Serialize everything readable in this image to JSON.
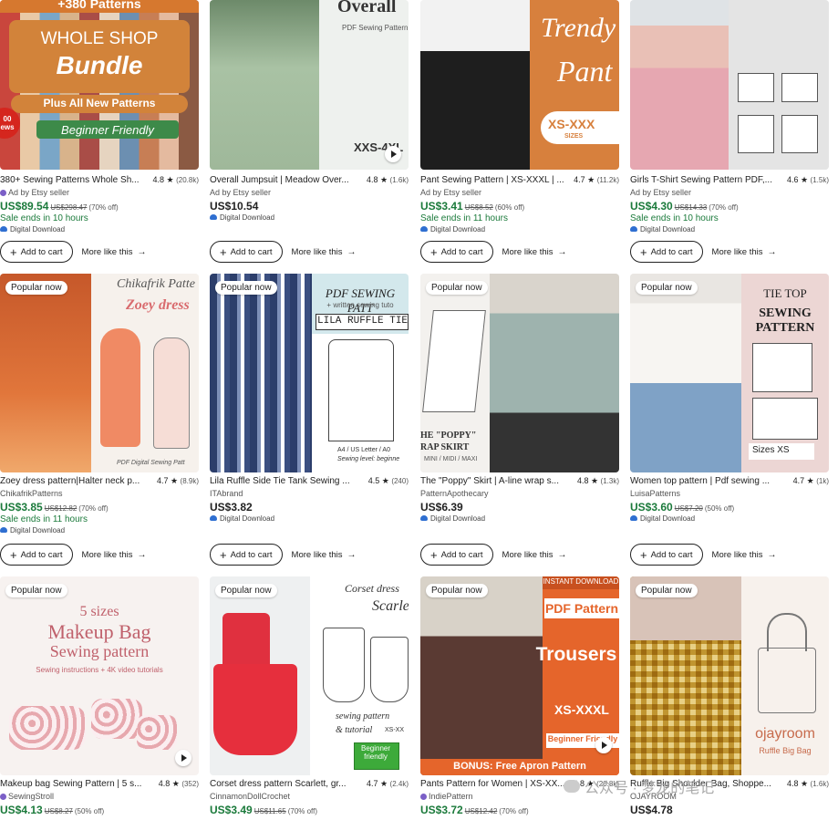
{
  "ui": {
    "add_to_cart": "Add to cart",
    "more_like_this": "More like this",
    "popular_now": "Popular now",
    "ad_by": "Ad by Etsy seller",
    "digital": "Digital Download"
  },
  "products": [
    {
      "title": "380+ Sewing Patterns Whole Sh...",
      "rating": "4.8 ★",
      "count": "(20.8k)",
      "seller": "Ad by Etsy seller",
      "price": "US$89.54",
      "orig": "US$298.47",
      "off": "(70% off)",
      "sale": "Sale ends in 10 hours",
      "digital": "Digital Download",
      "img": {
        "top": "+380 Patterns",
        "line1": "WHOLE SHOP",
        "line2": "Bundle",
        "line3": "Plus All New Patterns",
        "line4": "Beginner Friendly",
        "corner": "00 ews"
      }
    },
    {
      "title": "Overall Jumpsuit | Meadow Over...",
      "rating": "4.8 ★",
      "count": "(1.6k)",
      "seller": "Ad by Etsy seller",
      "price": "US$10.54",
      "digital": "Digital Download",
      "img": {
        "line1": "Overall",
        "line2": "PDF Sewing Pattern",
        "line3": "XXS-4XL"
      }
    },
    {
      "title": "Pant Sewing Pattern | XS-XXXL | ...",
      "rating": "4.7 ★",
      "count": "(11.2k)",
      "seller": "Ad by Etsy seller",
      "price": "US$3.41",
      "orig": "US$8.52",
      "off": "(60% off)",
      "sale": "Sale ends in 11 hours",
      "digital": "Digital Download",
      "img": {
        "line1": "Trendy",
        "line2": "Pant",
        "line3": "XS-XXX",
        "line4": "SIZES"
      }
    },
    {
      "title": "Girls T-Shirt Sewing Pattern PDF,...",
      "rating": "4.6 ★",
      "count": "(1.5k)",
      "seller": "Ad by Etsy seller",
      "price": "US$4.30",
      "orig": "US$14.33",
      "off": "(70% off)",
      "sale": "Sale ends in 10 hours",
      "digital": "Digital Download"
    },
    {
      "title": "Zoey dress pattern|Halter neck p...",
      "rating": "4.7 ★",
      "count": "(8.9k)",
      "seller": "ChikafrikPatterns",
      "price": "US$3.85",
      "orig": "US$12.82",
      "off": "(70% off)",
      "sale": "Sale ends in 11 hours",
      "digital": "Digital Download",
      "popular": true,
      "img": {
        "line1": "Chikafrik Patte",
        "line2": "Zoey dress",
        "line3": "PDF Digital Sewing Patt"
      }
    },
    {
      "title": "Lila Ruffle Side Tie Tank Sewing ...",
      "rating": "4.5 ★",
      "count": "(240)",
      "seller": "ITAbrand",
      "price": "US$3.82",
      "digital": "Digital Download",
      "popular": true,
      "img": {
        "line1": "PDF SEWING PATT",
        "line2": "+ written sewing tuto",
        "line3": "LILA RUFFLE TIE",
        "line4": "A4 / US Letter / A0",
        "line5": "Sewing level: beginne"
      }
    },
    {
      "title": "The \"Poppy\" Skirt | A-line wrap s...",
      "rating": "4.8 ★",
      "count": "(1.3k)",
      "seller": "PatternApothecary",
      "price": "US$6.39",
      "digital": "Digital Download",
      "popular": true,
      "img": {
        "line1": "HE \"POPPY\"",
        "line2": "RAP SKIRT",
        "line3": "MINI / MIDI / MAXI"
      }
    },
    {
      "title": "Women top pattern | Pdf sewing ...",
      "rating": "4.7 ★",
      "count": "(1k)",
      "seller": "LuisaPatterns",
      "price": "US$3.60",
      "orig": "US$7.20",
      "off": "(50% off)",
      "digital": "Digital Download",
      "popular": true,
      "img": {
        "line1": "TIE TOP",
        "line2": "SEWING",
        "line3": "PATTERN",
        "line4": "Sizes XS"
      }
    },
    {
      "title": "Makeup bag Sewing Pattern | 5 s...",
      "rating": "4.8 ★",
      "count": "(352)",
      "seller": "SewingStroll",
      "price": "US$4.13",
      "orig": "US$8.27",
      "off": "(50% off)",
      "popular": true,
      "img": {
        "line1": "5 sizes",
        "line2": "Makeup Bag",
        "line3": "Sewing pattern",
        "line4": "Sewing instructions + 4K video tutorials"
      }
    },
    {
      "title": "Corset dress pattern Scarlett, gr...",
      "rating": "4.7 ★",
      "count": "(2.4k)",
      "seller": "CinnamonDollCrochet",
      "price": "US$3.49",
      "orig": "US$11.65",
      "off": "(70% off)",
      "popular": true,
      "img": {
        "line1": "Corset dress",
        "line2": "Scarlet",
        "line3": "sewing pattern",
        "line4": "& tutorial",
        "line5": "XS-XX",
        "line6": "Beginner friendly"
      }
    },
    {
      "title": "Pants Pattern for Women | XS-XX...",
      "rating": "4.8 ★",
      "count": "(20.8k)",
      "seller": "IndiePattern",
      "price": "US$3.72",
      "orig": "US$12.42",
      "off": "(70% off)",
      "popular": true,
      "img": {
        "line1": "INSTANT DOWNLOAD",
        "line2": "PDF Pattern",
        "line3": "Trousers",
        "line4": "XS-XXXL",
        "line5": "Beginner Friendly",
        "line6": "BONUS: Free Apron Pattern"
      }
    },
    {
      "title": "Ruffle Big Shoulder Bag, Shoppe...",
      "rating": "4.8 ★",
      "count": "(1.6k)",
      "seller": "OJAYROOM",
      "price": "US$4.78",
      "popular": true,
      "img": {
        "line1": "ojayroom",
        "line2": "Ruffle Big Bag"
      }
    }
  ],
  "watermark": "公众号 · 梦龙的笔记"
}
